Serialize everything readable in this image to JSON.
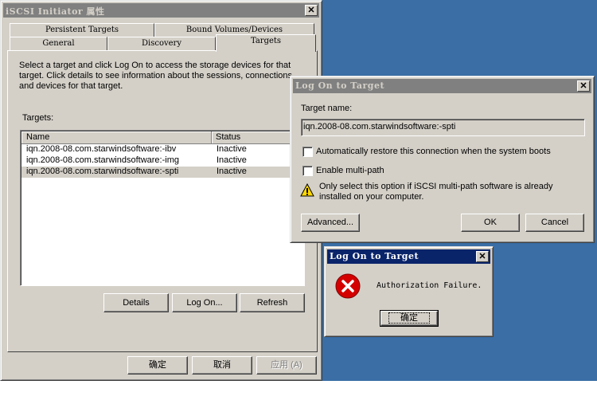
{
  "main_window": {
    "title": "iSCSI Initiator 属性",
    "tabs_back": [
      "Persistent Targets",
      "Bound Volumes/Devices"
    ],
    "tabs_front": [
      "General",
      "Discovery",
      "Targets"
    ],
    "active_tab": "Targets",
    "description": "Select a target and click Log On to access the storage devices for that target. Click details to see information about the sessions, connections and devices for that target.",
    "targets_label": "Targets:",
    "columns": [
      "Name",
      "Status"
    ],
    "targets": [
      {
        "name": "iqn.2008-08.com.starwindsoftware:-ibv",
        "status": "Inactive"
      },
      {
        "name": "iqn.2008-08.com.starwindsoftware:-img",
        "status": "Inactive"
      },
      {
        "name": "iqn.2008-08.com.starwindsoftware:-spti",
        "status": "Inactive",
        "selected": true
      }
    ],
    "details_button": "Details",
    "logon_button": "Log On...",
    "refresh_button": "Refresh",
    "ok_button": "确定",
    "cancel_button": "取消",
    "apply_button": "应用 (A)"
  },
  "logon_dialog": {
    "title": "Log On to Target",
    "target_name_label": "Target name:",
    "target_name_value": "iqn.2008-08.com.starwindsoftware:-spti",
    "restore_label": "Automatically restore this connection when the system boots",
    "restore_checked": false,
    "multipath_label": "Enable multi-path",
    "multipath_checked": false,
    "warning_text": "Only select this option if iSCSI multi-path software is already installed on your computer.",
    "advanced_button": "Advanced...",
    "ok_button": "OK",
    "cancel_button": "Cancel"
  },
  "error_dialog": {
    "title": "Log On to Target",
    "message": "Authorization Failure.",
    "ok_button": "确定"
  },
  "colors": {
    "desktop": "#3a6ea5",
    "active_title": "#0a246a",
    "inactive_title": "#808080",
    "face": "#d4d0c8"
  }
}
